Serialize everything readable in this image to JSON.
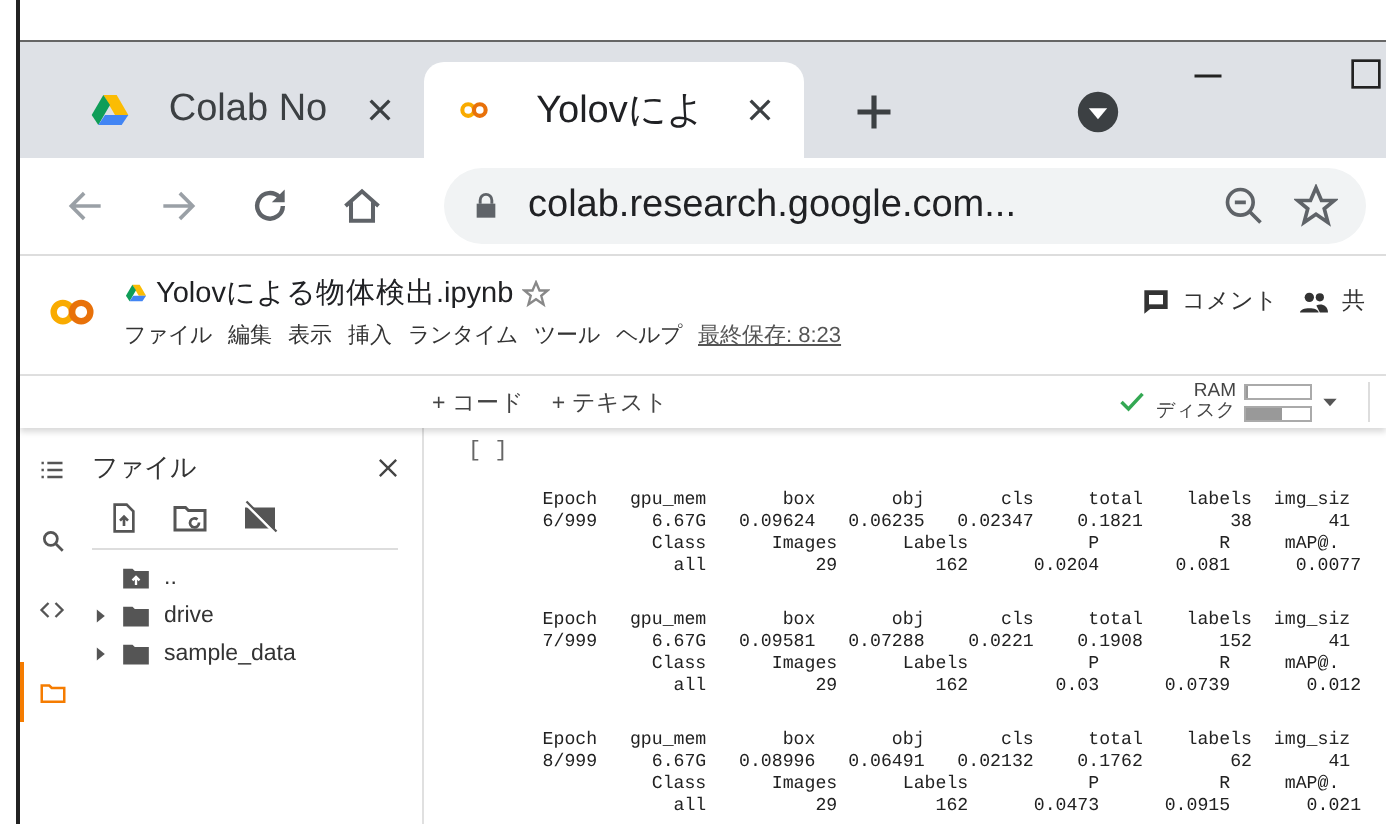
{
  "browser": {
    "tabs": [
      {
        "kind": "drive",
        "title": "Colab No",
        "selected": false
      },
      {
        "kind": "colab",
        "title": "Yolovによ",
        "selected": true
      }
    ],
    "back_disabled": true,
    "forward_disabled": true,
    "url": "colab.research.google.com..."
  },
  "notebook": {
    "title": "Yolovによる物体検出.ipynb",
    "menu": [
      "ファイル",
      "編集",
      "表示",
      "挿入",
      "ランタイム",
      "ツール",
      "ヘルプ"
    ],
    "last_saved": "最終保存: 8:23",
    "comment": "コメント",
    "share": "共"
  },
  "toolbar": {
    "add_code": "+ コード",
    "add_text": "+ テキスト",
    "ram_label": "RAM",
    "disk_label": "ディスク",
    "ram": {
      "level": 0.04
    },
    "disk": {
      "level": 0.55
    }
  },
  "sidebar": {
    "rail": [
      {
        "kind": "toc",
        "selected": false
      },
      {
        "kind": "search",
        "selected": false
      },
      {
        "kind": "code",
        "selected": false
      },
      {
        "kind": "files",
        "selected": true
      }
    ],
    "title": "ファイル",
    "files": [
      {
        "kind": "parent",
        "name": ".."
      },
      {
        "kind": "folder",
        "name": "drive",
        "expanded": false
      },
      {
        "kind": "folder",
        "name": "sample_data",
        "expanded": false
      }
    ]
  },
  "cell": {
    "run_marker": "[ ]",
    "blocks": [
      [
        "     Epoch   gpu_mem       box       obj       cls     total    labels  img_siz",
        "     6/999     6.67G   0.09624   0.06235   0.02347    0.1821        38       41",
        "               Class      Images      Labels           P           R     mAP@.",
        "                 all          29         162      0.0204       0.081      0.0077"
      ],
      [
        "     Epoch   gpu_mem       box       obj       cls     total    labels  img_siz",
        "     7/999     6.67G   0.09581   0.07288    0.0221    0.1908       152       41",
        "               Class      Images      Labels           P           R     mAP@.",
        "                 all          29         162        0.03      0.0739       0.012"
      ],
      [
        "     Epoch   gpu_mem       box       obj       cls     total    labels  img_siz",
        "     8/999     6.67G   0.08996   0.06491   0.02132    0.1762        62       41",
        "               Class      Images      Labels           P           R     mAP@.",
        "                 all          29         162      0.0473      0.0915       0.021"
      ]
    ]
  }
}
